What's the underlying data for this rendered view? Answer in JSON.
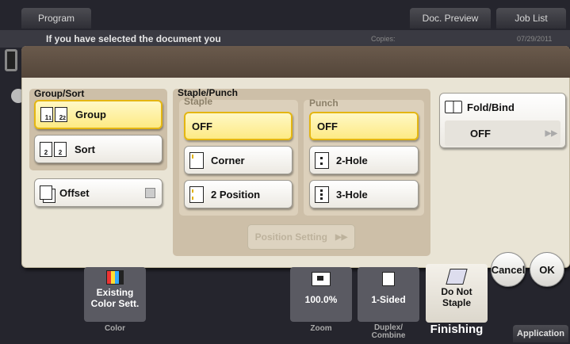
{
  "top": {
    "program": "Program",
    "doc_preview": "Doc. Preview",
    "job_list": "Job List",
    "message": "If you have selected the document you",
    "copies_label": "Copies:",
    "date": "07/29/2011"
  },
  "group_sort": {
    "title": "Group/Sort",
    "group": "Group",
    "sort": "Sort",
    "offset": "Offset"
  },
  "staple_punch": {
    "title": "Staple/Punch",
    "staple_title": "Staple",
    "staple_off": "OFF",
    "staple_corner": "Corner",
    "staple_2pos": "2 Position",
    "punch_title": "Punch",
    "punch_off": "OFF",
    "punch_2hole": "2-Hole",
    "punch_3hole": "3-Hole",
    "position_setting": "Position Setting"
  },
  "fold_bind": {
    "title": "Fold/Bind",
    "value": "OFF"
  },
  "actions": {
    "cancel": "Cancel",
    "ok": "OK"
  },
  "bottom": {
    "existing_color": "Existing\nColor Sett.",
    "color_tab": "Color",
    "zoom_value": "100.0%",
    "zoom_tab": "Zoom",
    "duplex_value": "1-Sided",
    "duplex_tab": "Duplex/\nCombine",
    "staple_value": "Do Not\nStaple",
    "finishing_tab": "Finishing",
    "application": "Application"
  },
  "colors": {
    "accent_yellow": "#fdea84",
    "dialog_bg": "#e9e4d5",
    "panel_bg": "#cdbfa8"
  }
}
